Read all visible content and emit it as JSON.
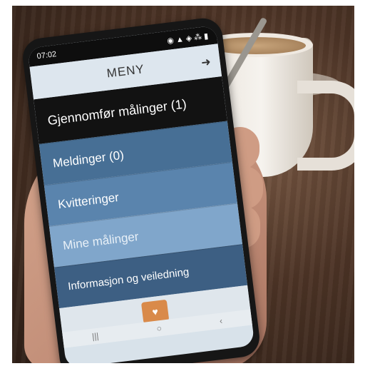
{
  "status": {
    "time": "07:02",
    "icons": "◉ ▲ ◈ ⁂ ▮"
  },
  "header": {
    "title": "MENY",
    "logout_icon": "logout-icon"
  },
  "menu": {
    "items": [
      {
        "label": "Gjennomfør målinger (1)"
      },
      {
        "label": "Meldinger (0)"
      },
      {
        "label": "Kvitteringer"
      },
      {
        "label": "Mine målinger"
      },
      {
        "label": "Informasjon og veiledning"
      }
    ]
  },
  "bottom": {
    "logo_icon": "heart-hands-logo"
  },
  "navbar": {
    "recent": "|||",
    "home": "○",
    "back": "‹"
  }
}
